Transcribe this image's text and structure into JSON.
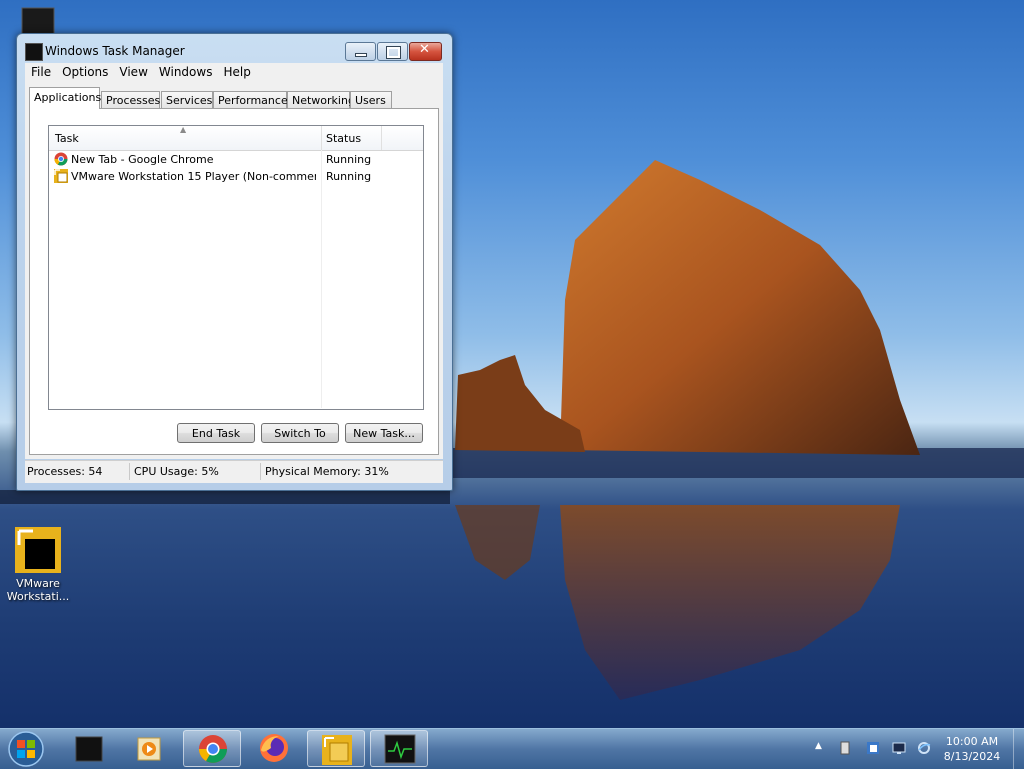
{
  "window": {
    "title": "Windows Task Manager",
    "menu": [
      "File",
      "Options",
      "View",
      "Windows",
      "Help"
    ],
    "tabs": [
      "Applications",
      "Processes",
      "Services",
      "Performance",
      "Networking",
      "Users"
    ],
    "active_tab": "Applications",
    "columns": {
      "task": "Task",
      "status": "Status"
    },
    "tasks": [
      {
        "name": "New Tab - Google Chrome",
        "status": "Running",
        "icon": "chrome-icon"
      },
      {
        "name": "VMware Workstation 15 Player (Non-commercial ...",
        "status": "Running",
        "icon": "vmware-icon"
      }
    ],
    "buttons": {
      "end_task": "End Task",
      "switch_to": "Switch To",
      "new_task": "New Task..."
    },
    "status": {
      "processes": "Processes: 54",
      "cpu": "CPU Usage: 5%",
      "memory": "Physical Memory: 31%"
    }
  },
  "desktop": {
    "icons": [
      {
        "label_line1": "VMware",
        "label_line2": "Workstati..."
      }
    ]
  },
  "clock": {
    "time": "10:00 AM",
    "date": "8/13/2024"
  },
  "colors": {
    "title_bar": "#bcd3ec",
    "close_button": "#d5543f",
    "taskbar": "#4a7fb5"
  }
}
